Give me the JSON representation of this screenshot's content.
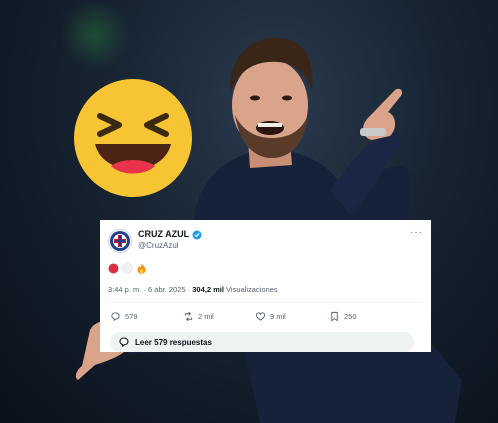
{
  "tweet": {
    "display_name": "CRUZ AZUL",
    "handle": "@CruzAzul",
    "more_glyph": "···",
    "body_emojis": [
      "red-circle",
      "white-circle",
      "fire"
    ],
    "time": "3:44 p. m.",
    "separator": " · ",
    "date": "6 abr. 2025",
    "views_count": "304,2 mil",
    "views_label": "Visualizaciones",
    "actions": {
      "replies": "579",
      "reposts": "2 mil",
      "likes": "9 mil",
      "bookmarks": "250"
    },
    "read_replies": "Leer 579 respuestas"
  },
  "colors": {
    "verified_blue": "#1d9bf0",
    "emoji_yellow": "#f7c433",
    "cruz_azul_blue": "#1f3e8c"
  },
  "icons": [
    "laughing-emoji-icon",
    "verified-badge-icon",
    "more-icon",
    "reply-icon",
    "repost-icon",
    "like-icon",
    "bookmark-icon",
    "chat-bubble-icon"
  ]
}
